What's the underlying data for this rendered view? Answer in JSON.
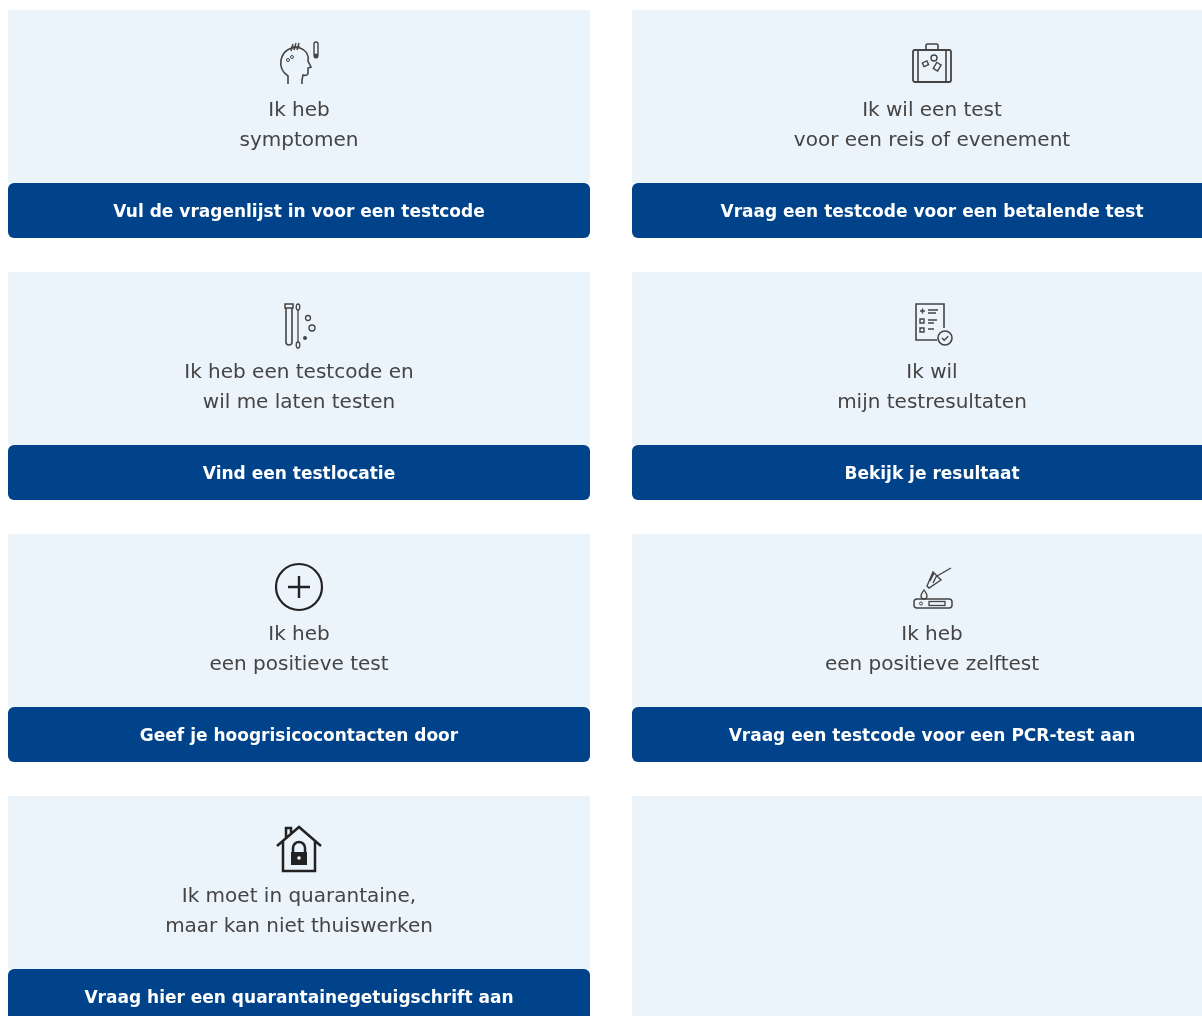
{
  "cards": [
    {
      "kind": "symptoms",
      "lines": [
        "Ik heb",
        "symptomen"
      ],
      "button": "Vul de vragenlijst in voor een testcode"
    },
    {
      "kind": "travel",
      "lines": [
        "Ik wil een test",
        "voor een reis of evenement"
      ],
      "button": "Vraag een testcode voor een betalende test"
    },
    {
      "kind": "swab",
      "lines": [
        "Ik heb een testcode en",
        "wil me laten testen"
      ],
      "button": "Vind een testlocatie"
    },
    {
      "kind": "results",
      "lines": [
        "Ik wil",
        "mijn testresultaten"
      ],
      "button": "Bekijk je resultaat"
    },
    {
      "kind": "positive",
      "lines": [
        "Ik heb",
        "een positieve test"
      ],
      "button": "Geef je hoogrisicocontacten door"
    },
    {
      "kind": "selftest",
      "lines": [
        "Ik heb",
        "een positieve zelftest"
      ],
      "button": "Vraag een testcode voor een PCR-test aan"
    },
    {
      "kind": "quarantine",
      "lines": [
        "Ik moet in quarantaine,",
        "maar kan niet thuiswerken"
      ],
      "button": "Vraag hier een quarantainegetuigschrift aan"
    },
    {
      "kind": "blank"
    }
  ]
}
